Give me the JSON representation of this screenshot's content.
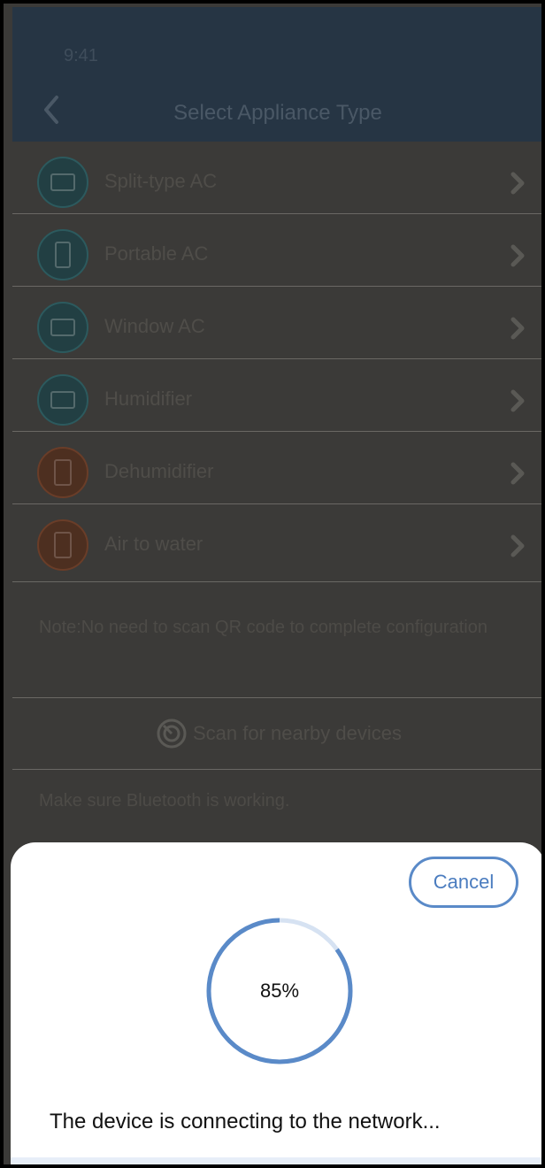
{
  "status_bar": {
    "time": "9:41"
  },
  "header": {
    "title": "Select Appliance Type"
  },
  "appliances": [
    {
      "label": "Split-type AC",
      "icon": "split-ac-icon",
      "tone": "teal"
    },
    {
      "label": "Portable AC",
      "icon": "portable-ac-icon",
      "tone": "teal"
    },
    {
      "label": "Window AC",
      "icon": "window-ac-icon",
      "tone": "teal"
    },
    {
      "label": "Humidifier",
      "icon": "humidifier-icon",
      "tone": "teal"
    },
    {
      "label": "Dehumidifier",
      "icon": "dehumidifier-icon",
      "tone": "brown"
    },
    {
      "label": "Air to water",
      "icon": "air-to-water-icon",
      "tone": "brown"
    }
  ],
  "note": "Note:No need to scan QR code to complete configuration",
  "scan": {
    "label": "Scan for nearby devices"
  },
  "hint": "Make sure Bluetooth is working.",
  "dialog": {
    "cancel_label": "Cancel",
    "progress_value": 85,
    "progress_text": "85%",
    "message": "The device is connecting to the network..."
  },
  "colors": {
    "overlay_background": "#3b3a38",
    "header_background": "#263544",
    "accent": "#5a8ac8",
    "progress_track": "#d6e2f2"
  }
}
